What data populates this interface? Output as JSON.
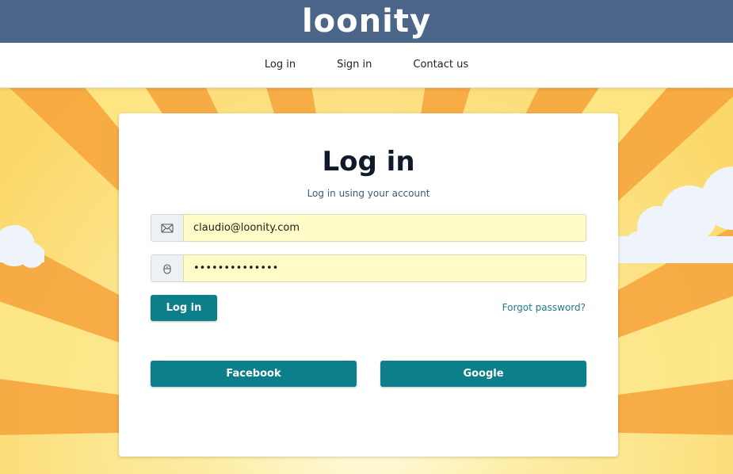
{
  "brand": {
    "name": "loonity",
    "header_color": "#4b6688"
  },
  "nav": {
    "items": [
      {
        "label": "Log in"
      },
      {
        "label": "Sign in"
      },
      {
        "label": "Contact us"
      }
    ]
  },
  "login_card": {
    "title": "Log in",
    "subtitle": "Log in using your account",
    "email": {
      "icon": "envelope-icon",
      "value": "claudio@loonity.com"
    },
    "password": {
      "icon": "lock-icon",
      "value": "••••••••••••••"
    },
    "login_button_label": "Log in",
    "forgot_password_label": "Forgot password?",
    "social": {
      "facebook_label": "Facebook",
      "google_label": "Google"
    }
  },
  "colors": {
    "accent": "#0c7f8b",
    "input_background": "#fefbc8",
    "link": "#1f7a8c",
    "sun_light": "#fde98a",
    "sun_dark": "#f7a33b"
  }
}
